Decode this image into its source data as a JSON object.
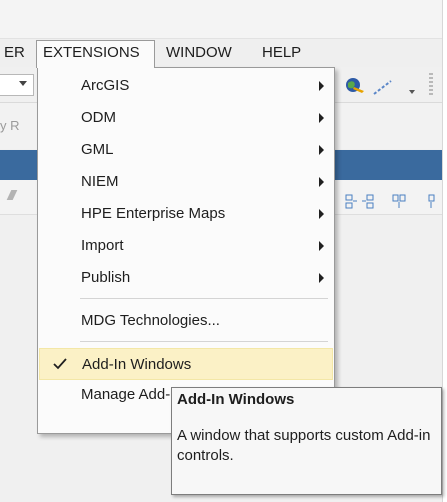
{
  "menubar": {
    "items": [
      {
        "label": "ER"
      },
      {
        "label": "EXTENSIONS"
      },
      {
        "label": "WINDOW"
      },
      {
        "label": "HELP"
      }
    ]
  },
  "background": {
    "faint_text": "y R"
  },
  "extensions_menu": {
    "items": [
      {
        "label": "ArcGIS",
        "submenu": true
      },
      {
        "label": "ODM",
        "submenu": true
      },
      {
        "label": "GML",
        "submenu": true
      },
      {
        "label": "NIEM",
        "submenu": true
      },
      {
        "label": "HPE Enterprise Maps",
        "submenu": true
      },
      {
        "label": "Import",
        "submenu": true
      },
      {
        "label": "Publish",
        "submenu": true
      },
      {
        "label": "MDG Technologies...",
        "submenu": false
      },
      {
        "label": "Add-In Windows",
        "submenu": false,
        "checked": true,
        "highlighted": true
      },
      {
        "label": "Manage Add-Ins",
        "submenu": false
      }
    ]
  },
  "tooltip": {
    "title": "Add-In Windows",
    "body": "A window that supports custom Add-in controls."
  },
  "colors": {
    "menu_highlight": "#fbf1c6",
    "title_bar_blue": "#3a6a9e",
    "tooltip_bg": "#f7f7f7"
  },
  "icons": {
    "globe": "globe-icon",
    "connector": "connector-icon",
    "check": "check-icon",
    "submenu_arrow": "chevron-right-icon",
    "align_tools": "align-icon"
  }
}
